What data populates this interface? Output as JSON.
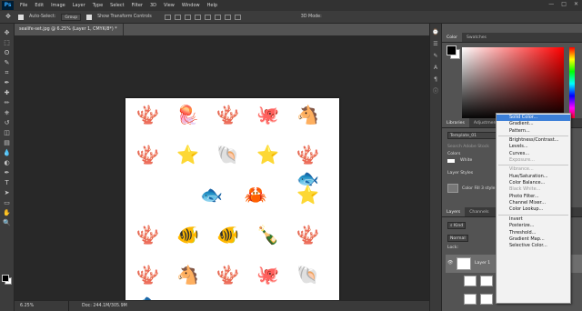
{
  "app": {
    "logo": "Ps"
  },
  "menubar": {
    "items": [
      "File",
      "Edit",
      "Image",
      "Layer",
      "Type",
      "Select",
      "Filter",
      "3D",
      "View",
      "Window",
      "Help"
    ]
  },
  "window_controls": [
    "—",
    "□",
    "✕"
  ],
  "optionsbar": {
    "auto_select_label": "Auto-Select:",
    "auto_select_value": "Group",
    "transform_label": "Show Transform Controls",
    "mode_3d": "3D Mode:"
  },
  "toolbar": {
    "tools": [
      "move-tool",
      "marquee-tool",
      "lasso-tool",
      "quick-select-tool",
      "crop-tool",
      "eyedropper-tool",
      "healing-tool",
      "brush-tool",
      "stamp-tool",
      "history-brush-tool",
      "eraser-tool",
      "gradient-tool",
      "blur-tool",
      "dodge-tool",
      "pen-tool",
      "type-tool",
      "path-select-tool",
      "shape-tool",
      "hand-tool",
      "zoom-tool"
    ],
    "glyphs": [
      "✥",
      "⬚",
      "ʘ",
      "✎",
      "⌗",
      "✒",
      "✚",
      "✏",
      "⎈",
      "↺",
      "◫",
      "▤",
      "💧",
      "◐",
      "✒",
      "T",
      "➤",
      "▭",
      "✋",
      "🔍"
    ]
  },
  "document": {
    "tab_label": "sealife-set.jpg @ 6.25% (Layer 1, CMYK/8*) *",
    "close": "×"
  },
  "canvas": {
    "creatures": [
      {
        "glyph": "🪸",
        "color": "#f0a030"
      },
      {
        "glyph": "🪼",
        "color": "#e0b040"
      },
      {
        "glyph": "🪸",
        "color": "#d33"
      },
      {
        "glyph": "🐙",
        "color": "#7b4fa0"
      },
      {
        "glyph": "🐴",
        "color": "#2aa0b8"
      },
      {
        "glyph": "🪸",
        "color": "#e84030"
      },
      {
        "glyph": "⭐",
        "color": "#e64"
      },
      {
        "glyph": "🐚",
        "color": "#e88040"
      },
      {
        "glyph": "⭐",
        "color": "#e33"
      },
      {
        "glyph": "🪸",
        "color": "#e0c050"
      },
      {
        "glyph": "🐟",
        "color": "#e85050"
      },
      {
        "glyph": "🐟",
        "color": "#3090c8"
      },
      {
        "glyph": "🦀",
        "color": "#d33"
      },
      {
        "glyph": "⭐",
        "color": "#e44"
      },
      {
        "glyph": "🪸",
        "color": "#30a0c8"
      },
      {
        "glyph": "🐠",
        "color": "#e46020"
      },
      {
        "glyph": "🐠",
        "color": "#e0c020"
      },
      {
        "glyph": "🍾",
        "color": "#88c0c0"
      },
      {
        "glyph": "🪸",
        "color": "#2aa0c0"
      },
      {
        "glyph": "🪸",
        "color": "#40b0c8"
      },
      {
        "glyph": "🐴",
        "color": "#f08030"
      },
      {
        "glyph": "🪸",
        "color": "#90b030"
      },
      {
        "glyph": "🐙",
        "color": "#e06020"
      },
      {
        "glyph": "🐚",
        "color": "#e07030"
      },
      {
        "glyph": "🐟",
        "color": "#4050b0"
      }
    ]
  },
  "status": {
    "zoom": "6.25%",
    "doc_size": "Doc: 244.1M/305.9M"
  },
  "color_panel": {
    "tabs": [
      "Color",
      "Swatches"
    ]
  },
  "libraries_panel": {
    "tabs": [
      "Libraries",
      "Adjustments"
    ],
    "library_select": "Template_01",
    "search_placeholder": "Search Adobe Stock",
    "colors_label": "Colors",
    "swatch_label": "White",
    "layer_styles_label": "Layer Styles",
    "style_name": "Color Fill 3 style"
  },
  "layers_panel": {
    "tabs": [
      "Layers",
      "Channels",
      "Paths"
    ],
    "kind": "Kind",
    "blend": "Normal",
    "lock_label": "Lock:",
    "layer_name": "Layer 1"
  },
  "dropdown_menu": {
    "items": [
      {
        "label": "Solid Color...",
        "state": "highlight"
      },
      {
        "label": "Gradient...",
        "state": "normal"
      },
      {
        "label": "Pattern...",
        "state": "normal"
      },
      {
        "sep": true
      },
      {
        "label": "Brightness/Contrast...",
        "state": "normal"
      },
      {
        "label": "Levels...",
        "state": "normal"
      },
      {
        "label": "Curves...",
        "state": "normal"
      },
      {
        "label": "Exposure...",
        "state": "disabled"
      },
      {
        "sep": true
      },
      {
        "label": "Vibrance...",
        "state": "disabled"
      },
      {
        "label": "Hue/Saturation...",
        "state": "normal"
      },
      {
        "label": "Color Balance...",
        "state": "normal"
      },
      {
        "label": "Black  White...",
        "state": "disabled"
      },
      {
        "label": "Photo Filter...",
        "state": "normal"
      },
      {
        "label": "Channel Mixer...",
        "state": "normal"
      },
      {
        "label": "Color Lookup...",
        "state": "normal"
      },
      {
        "sep": true
      },
      {
        "label": "Invert",
        "state": "normal"
      },
      {
        "label": "Posterize...",
        "state": "normal"
      },
      {
        "label": "Threshold...",
        "state": "normal"
      },
      {
        "label": "Gradient Map...",
        "state": "normal"
      },
      {
        "label": "Selective Color...",
        "state": "normal"
      }
    ]
  }
}
